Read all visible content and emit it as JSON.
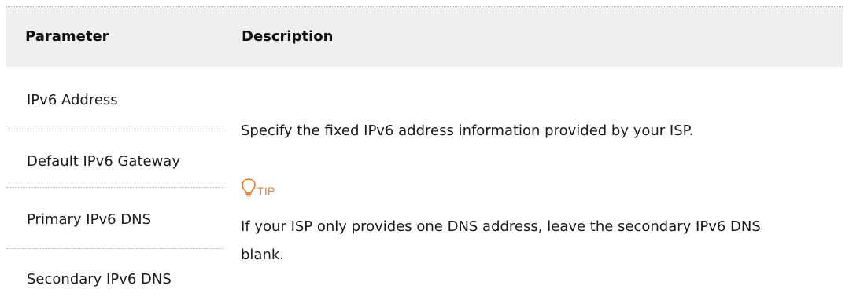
{
  "table": {
    "header": {
      "parameter": "Parameter",
      "description": "Description"
    },
    "parameters": [
      "IPv6 Address",
      "Default IPv6 Gateway",
      "Primary IPv6 DNS",
      "Secondary IPv6 DNS"
    ],
    "description": {
      "main": "Specify the fixed IPv6 address information provided by your ISP.",
      "tip_label": "TIP",
      "tip_icon": "lightbulb-icon",
      "tip_text": "If your ISP only provides one DNS address, leave the secondary IPv6 DNS blank."
    }
  },
  "colors": {
    "header_bg": "#efefef",
    "tip_accent": "#f07b1d",
    "rule": "#b8b8b8"
  }
}
